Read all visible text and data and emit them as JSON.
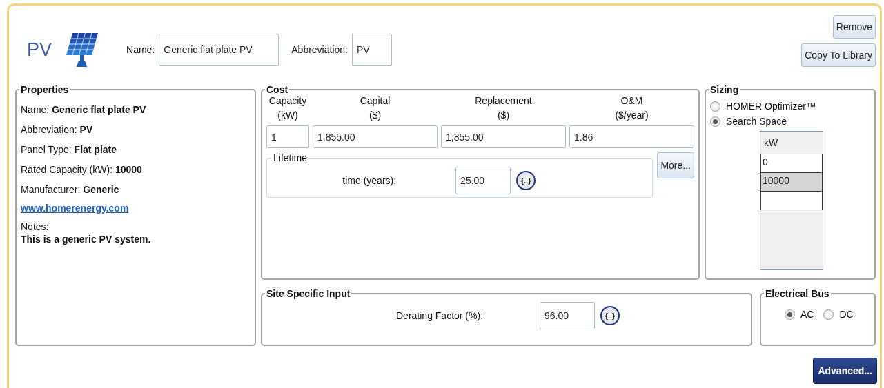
{
  "header": {
    "title": "PV",
    "name_label": "Name:",
    "name_value": "Generic flat plate PV",
    "abbreviation_label": "Abbreviation:",
    "abbreviation_value": "PV"
  },
  "actions": [
    "Remove",
    "Copy To Library"
  ],
  "properties": {
    "title": "Properties",
    "items": [
      "Name: **Generic flat plate PV**",
      "Abbreviation: **PV**",
      "Panel Type: **Flat plate**",
      "Rated Capacity (kW): **10000**",
      "Manufacturer: **Generic**"
    ],
    "link": "www.homerenergy.com",
    "notes_label": "Notes:",
    "notes": "This is a generic PV system."
  },
  "cost": {
    "title": "Cost",
    "columns": [
      {
        "heading": "Capacity",
        "unit": "(kW)",
        "value": "1"
      },
      {
        "heading": "Capital",
        "unit": "($)",
        "value": "1,855.00"
      },
      {
        "heading": "Replacement",
        "unit": "($)",
        "value": "1,855.00"
      },
      {
        "heading": "O&M",
        "unit": "($/year)",
        "value": "1.86"
      }
    ],
    "lifetime": {
      "title": "Lifetime",
      "label": "time (years):",
      "value": "25.00",
      "variable_button": "{..}"
    },
    "more_button": "More..."
  },
  "sizing": {
    "title": "Sizing",
    "options": [
      {
        "label": "HOMER Optimizer™",
        "selected": false
      },
      {
        "label": "Search Space",
        "selected": true
      }
    ],
    "table": {
      "column": "kW",
      "rows": [
        {
          "value": "0",
          "selected": false
        },
        {
          "value": "10000",
          "selected": true
        }
      ]
    }
  },
  "site": {
    "title": "Site Specific Input",
    "label": "Derating Factor (%):",
    "value": "96.00",
    "variable_button": "{..}"
  },
  "bus": {
    "title": "Electrical Bus",
    "options": [
      {
        "label": "AC",
        "selected": true
      },
      {
        "label": "DC",
        "selected": false
      }
    ]
  },
  "advanced_button": "Advanced..."
}
